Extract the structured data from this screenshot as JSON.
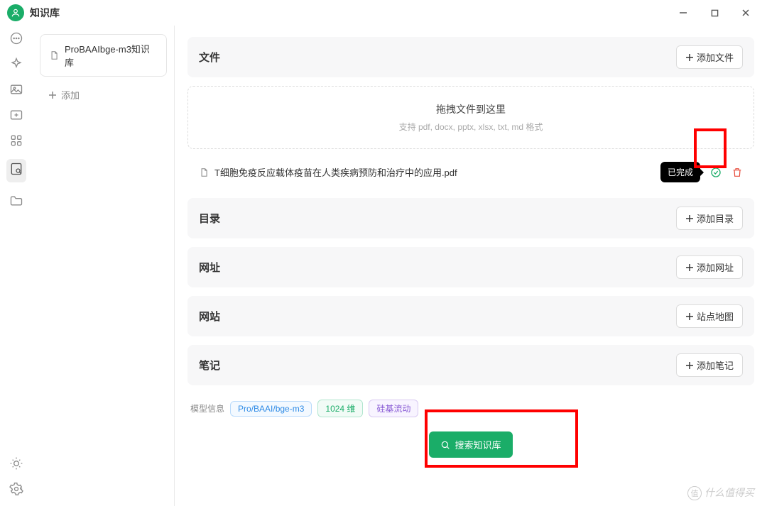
{
  "titlebar": {
    "title": "知识库"
  },
  "sidebar": {
    "items": [
      {
        "label": "ProBAAIbge-m3知识库"
      }
    ],
    "add_label": "添加"
  },
  "sections": {
    "files": {
      "title": "文件",
      "add": "添加文件"
    },
    "dirs": {
      "title": "目录",
      "add": "添加目录"
    },
    "urls": {
      "title": "网址",
      "add": "添加网址"
    },
    "sites": {
      "title": "网站",
      "add": "站点地图"
    },
    "notes": {
      "title": "笔记",
      "add": "添加笔记"
    }
  },
  "dropzone": {
    "title": "拖拽文件到这里",
    "sub": "支持 pdf, docx, pptx, xlsx, txt, md 格式"
  },
  "files": [
    {
      "name": "T细胞免疫反应载体疫苗在人类疾病预防和治疗中的应用.pdf",
      "status": "已完成"
    }
  ],
  "model": {
    "label": "模型信息",
    "tags": {
      "name": "Pro/BAAI/bge-m3",
      "dim": "1024 维",
      "provider": "硅基流动"
    }
  },
  "search": {
    "label": "搜索知识库"
  },
  "watermark": "什么值得买"
}
